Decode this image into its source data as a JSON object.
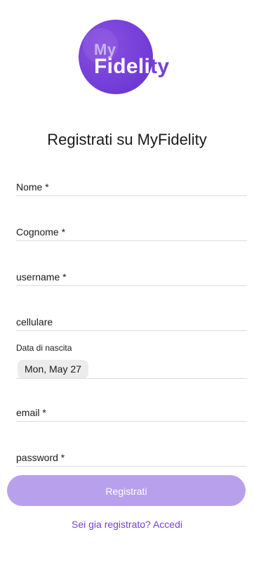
{
  "logo": {
    "line1": "My",
    "line2_main": "Fideli",
    "line2_tail": "ty"
  },
  "title": "Registrati su MyFidelity",
  "fields": {
    "nome": "Nome *",
    "cognome": "Cognome *",
    "username": "username *",
    "cellulare": "cellulare",
    "email": "email *",
    "password": "password *"
  },
  "date": {
    "label": "Data di nascita",
    "value": "Mon, May 27"
  },
  "submit_label": "Registrati",
  "login_link": "Sei gia registrato? Accedi",
  "colors": {
    "accent": "#7440d8",
    "button": "#b9a0ec"
  }
}
